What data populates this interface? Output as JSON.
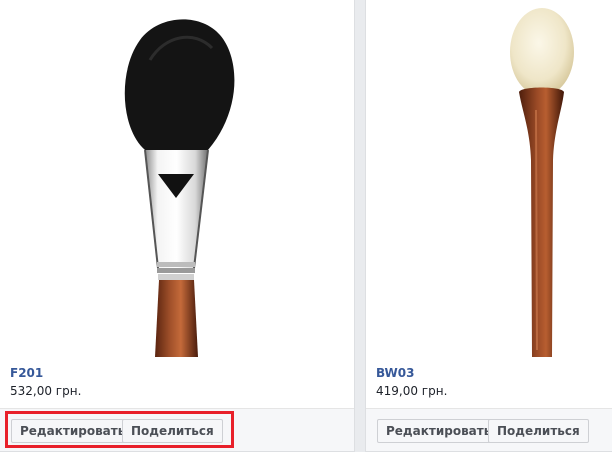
{
  "products": [
    {
      "title": "F201",
      "price": "532,00 грн.",
      "image_icon": "makeup-brush-image",
      "buttons": {
        "edit": "Редактировать",
        "share": "Поделиться"
      }
    },
    {
      "title": "BW03",
      "price": "419,00 грн.",
      "image_icon": "makeup-brush-image",
      "buttons": {
        "edit": "Редактировать",
        "share": "Поделиться"
      }
    }
  ],
  "colors": {
    "title_link": "#365899",
    "highlight_border": "#e8202a",
    "page_bg": "#e9ebee"
  }
}
